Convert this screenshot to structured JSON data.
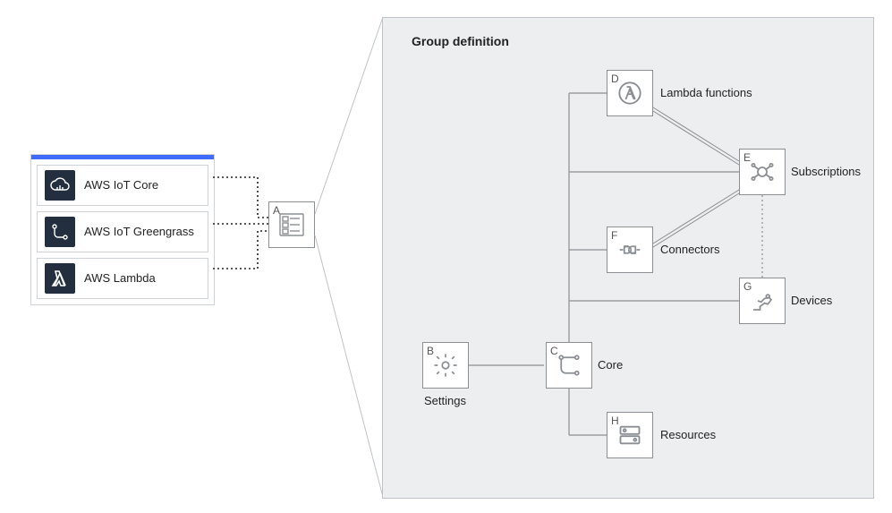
{
  "services": {
    "items": [
      {
        "icon": "aws-iot-core-icon",
        "label": "AWS IoT Core"
      },
      {
        "icon": "aws-iot-greengrass-icon",
        "label": "AWS IoT Greengrass"
      },
      {
        "icon": "aws-lambda-icon",
        "label": "AWS Lambda"
      }
    ]
  },
  "nodes": {
    "A": {
      "letter": "A",
      "label": "A"
    },
    "B": {
      "letter": "B",
      "label": "Settings"
    },
    "C": {
      "letter": "C",
      "label": "Core"
    },
    "D": {
      "letter": "D",
      "label": "Lambda functions"
    },
    "E": {
      "letter": "E",
      "label": "Subscriptions"
    },
    "F": {
      "letter": "F",
      "label": "Connectors"
    },
    "G": {
      "letter": "G",
      "label": "Devices"
    },
    "H": {
      "letter": "H",
      "label": "Resources"
    }
  },
  "panel": {
    "title": "Group definition"
  },
  "colors": {
    "darkNavy": "#232f3e",
    "accentBlue": "#3f6bff",
    "panelBg": "#eceef0",
    "border": "#bfc3c7"
  }
}
